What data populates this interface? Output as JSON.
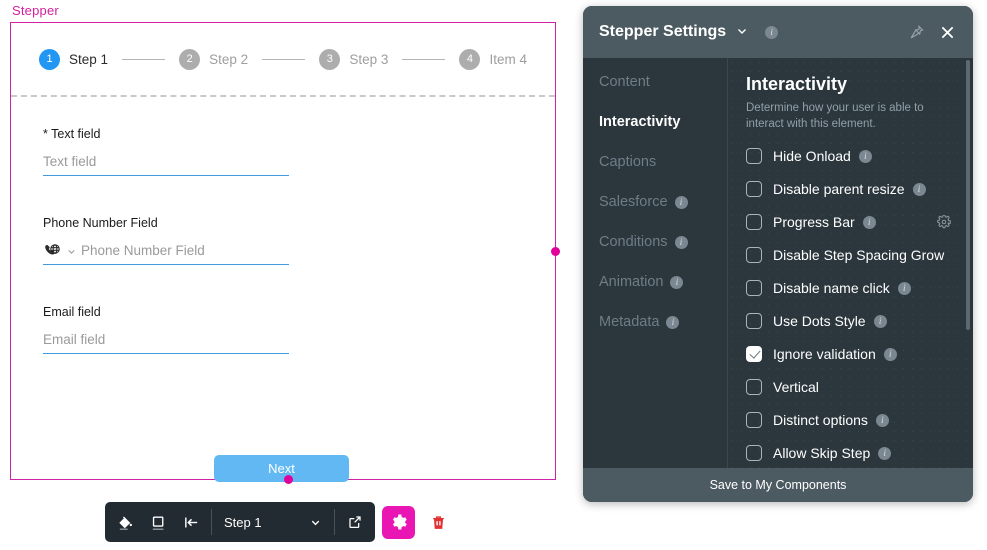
{
  "canvas": {
    "component_label": "Stepper",
    "accent_color": "#cf23a6",
    "stepper": {
      "steps": [
        {
          "number": "1",
          "label": "Step 1",
          "active": true
        },
        {
          "number": "2",
          "label": "Step 2",
          "active": false
        },
        {
          "number": "3",
          "label": "Step 3",
          "active": false
        },
        {
          "number": "4",
          "label": "Item 4",
          "active": false
        }
      ],
      "active_color": "#2196f3",
      "inactive_color": "#adadad"
    },
    "fields": [
      {
        "label": "Text field",
        "required_marker": "*",
        "placeholder": "Text field",
        "value": ""
      },
      {
        "label": "Phone Number Field",
        "required_marker": "",
        "placeholder": "Phone Number Field",
        "value": ""
      },
      {
        "label": "Email field",
        "required_marker": "",
        "placeholder": "Email field",
        "value": ""
      }
    ],
    "next_button": "Next"
  },
  "toolbar": {
    "fill_icon": "paint-bucket-icon",
    "border_icon": "border-square-icon",
    "align_icon": "align-left-icon",
    "step_select_value": "Step 1",
    "open_icon": "external-link-icon",
    "settings_icon": "gear-icon",
    "delete_icon": "trash-icon",
    "gear_color": "#e916b4",
    "trash_color": "#e03131"
  },
  "panel": {
    "title": "Stepper Settings",
    "title_chevron": "chevron-down-icon",
    "info_glyph": "i",
    "pin_icon": "pin-icon",
    "close_icon": "close-icon",
    "nav": [
      {
        "label": "Content",
        "active": false,
        "info": false
      },
      {
        "label": "Interactivity",
        "active": true,
        "info": false
      },
      {
        "label": "Captions",
        "active": false,
        "info": false
      },
      {
        "label": "Salesforce",
        "active": false,
        "info": true
      },
      {
        "label": "Conditions",
        "active": false,
        "info": true
      },
      {
        "label": "Animation",
        "active": false,
        "info": true
      },
      {
        "label": "Metadata",
        "active": false,
        "info": true
      }
    ],
    "content": {
      "title": "Interactivity",
      "description": "Determine how your user is able to interact with this element.",
      "options": [
        {
          "label": "Hide Onload",
          "checked": false,
          "info": true,
          "gear": false
        },
        {
          "label": "Disable parent resize",
          "checked": false,
          "info": true,
          "gear": false
        },
        {
          "label": "Progress Bar",
          "checked": false,
          "info": true,
          "gear": true
        },
        {
          "label": "Disable Step Spacing Grow",
          "checked": false,
          "info": false,
          "gear": false
        },
        {
          "label": "Disable name click",
          "checked": false,
          "info": true,
          "gear": false
        },
        {
          "label": "Use Dots Style",
          "checked": false,
          "info": true,
          "gear": false
        },
        {
          "label": "Ignore validation",
          "checked": true,
          "info": true,
          "gear": false
        },
        {
          "label": "Vertical",
          "checked": false,
          "info": false,
          "gear": false
        },
        {
          "label": "Distinct options",
          "checked": false,
          "info": true,
          "gear": false
        },
        {
          "label": "Allow Skip Step",
          "checked": false,
          "info": true,
          "gear": false
        }
      ]
    },
    "footer_button": "Save to My Components"
  }
}
